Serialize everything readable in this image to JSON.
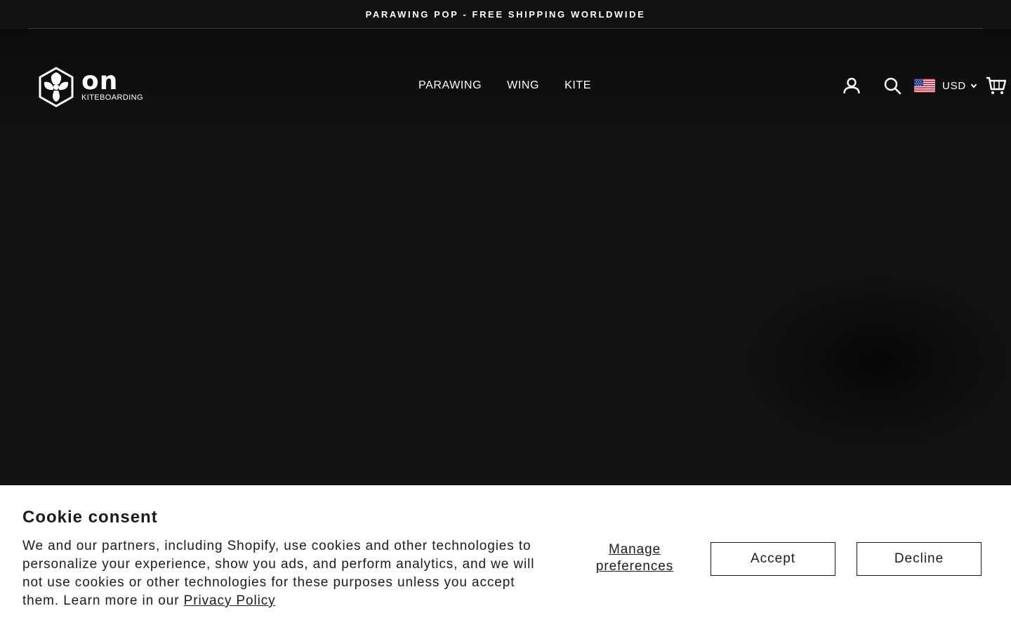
{
  "announcement": {
    "text": "PARAWING POP - FREE SHIPPING WORLDWIDE"
  },
  "header": {
    "logo": {
      "wordmark": "on",
      "subtitle": "KITEBOARDING"
    },
    "nav": [
      {
        "label": "PARAWING"
      },
      {
        "label": "WING"
      },
      {
        "label": "KITE"
      }
    ],
    "icons": {
      "account": "account-icon",
      "search": "search-icon",
      "cart": "cart-icon"
    },
    "currency": {
      "selected": "USD",
      "flag": "us-flag-icon"
    }
  },
  "cookie": {
    "title": "Cookie consent",
    "body": "We and our partners, including Shopify, use cookies and other technologies to personalize your experience, show you ads, and perform analytics, and we will not use cookies or other technologies for these purposes unless you accept them. Learn more in our ",
    "link_label": "Privacy Policy",
    "manage_label": "Manage preferences",
    "accept_label": "Accept",
    "decline_label": "Decline"
  },
  "colors": {
    "background": "#121212",
    "header_text": "#ffffff",
    "banner_bg": "#ffffff",
    "banner_text": "#1b1b1b"
  }
}
